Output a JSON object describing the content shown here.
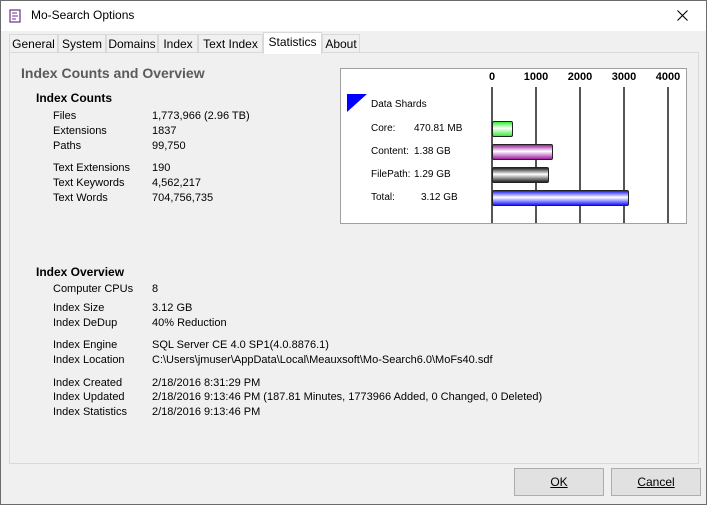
{
  "window": {
    "title": "Mo-Search Options"
  },
  "tabs": [
    "General",
    "System",
    "Domains",
    "Index",
    "Text Index",
    "Statistics",
    "About"
  ],
  "active_tab": "Statistics",
  "main": {
    "heading": "Index Counts and Overview",
    "counts": {
      "title": "Index Counts",
      "rows": [
        {
          "label": "Files",
          "value": "1,773,966 (2.96 TB)"
        },
        {
          "label": "Extensions",
          "value": "1837"
        },
        {
          "label": "Paths",
          "value": "99,750"
        },
        {
          "label": "Text Extensions",
          "value": "190"
        },
        {
          "label": "Text Keywords",
          "value": "4,562,217"
        },
        {
          "label": "Text Words",
          "value": "704,756,735"
        }
      ]
    },
    "overview": {
      "title": "Index Overview",
      "rows": [
        {
          "label": "Computer CPUs",
          "value": "8"
        },
        {
          "label": "Index Size",
          "value": "3.12 GB"
        },
        {
          "label": "Index DeDup",
          "value": "40% Reduction"
        },
        {
          "label": "Index Engine",
          "value": "SQL Server CE 4.0 SP1(4.0.8876.1)"
        },
        {
          "label": "Index Location",
          "value": "C:\\Users\\jmuser\\AppData\\Local\\Meauxsoft\\Mo-Search6.0\\MoFs40.sdf"
        },
        {
          "label": "Index Created",
          "value": "2/18/2016 8:31:29 PM"
        },
        {
          "label": "Index Updated",
          "value": "2/18/2016 9:13:46 PM  (187.81 Minutes, 1773966 Added, 0 Changed, 0 Deleted)"
        },
        {
          "label": "Index Statistics",
          "value": "2/18/2016 9:13:46 PM"
        }
      ]
    }
  },
  "chart_data": {
    "type": "bar",
    "orientation": "horizontal",
    "legend": "Data Shards",
    "xticks": [
      "0",
      "1000",
      "2000",
      "3000",
      "4000"
    ],
    "xlim": [
      0,
      4000
    ],
    "categories": [
      "Core:",
      "Content:",
      "FilePath:",
      "Total:"
    ],
    "value_labels": [
      "470.81 MB",
      "1.38 GB",
      "1.29 GB",
      "3.12 GB"
    ],
    "values": [
      470.81,
      1380,
      1290,
      3120
    ],
    "colors": [
      "#33ee33",
      "#a020a0",
      "#222222",
      "#1a1aff"
    ]
  },
  "buttons": {
    "ok": "OK",
    "cancel": "Cancel"
  }
}
